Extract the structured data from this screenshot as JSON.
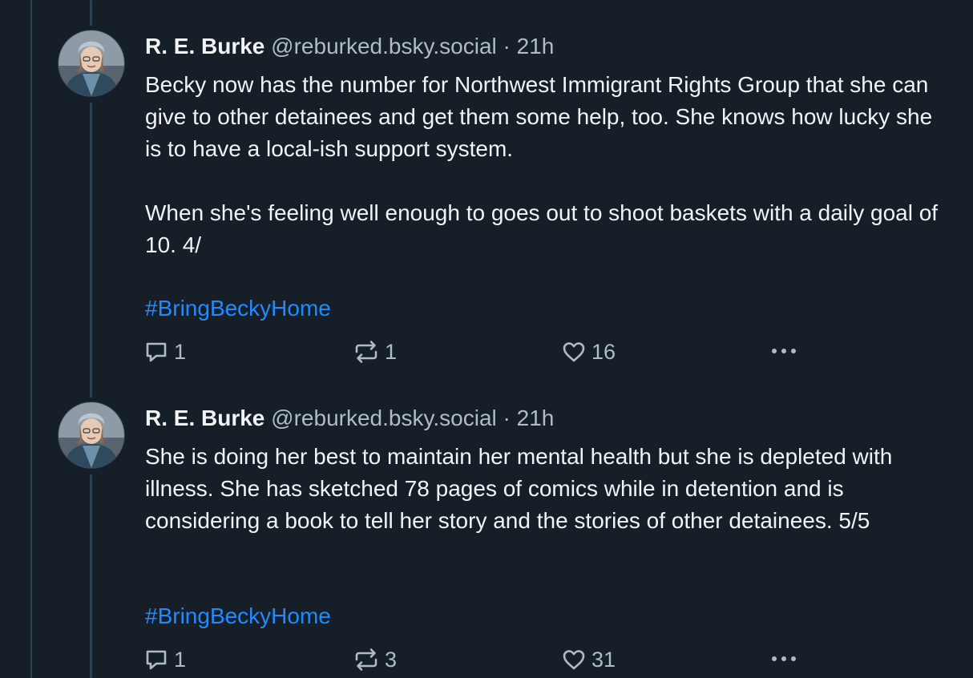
{
  "posts": [
    {
      "author": "R. E. Burke",
      "handle": "@reburked.bsky.social",
      "separator": "·",
      "time": "21h",
      "paragraphs": [
        "Becky now has the number for Northwest Immigrant Rights Group that she can give to other detainees and get them some help, too. She knows how lucky she is to have a local-ish support system.",
        "When she's feeling well enough to goes out to shoot baskets with a daily goal of 10. 4/"
      ],
      "hashtag": "#BringBeckyHome",
      "replies": "1",
      "reposts": "1",
      "likes": "16"
    },
    {
      "author": "R. E. Burke",
      "handle": "@reburked.bsky.social",
      "separator": "·",
      "time": "21h",
      "paragraphs": [
        "She is doing her best to maintain her mental health but she is depleted with illness. She has sketched 78 pages of comics while in detention and is considering a book to tell her story and the stories of other detainees. 5/5"
      ],
      "hashtag": "#BringBeckyHome",
      "replies": "1",
      "reposts": "3",
      "likes": "31"
    }
  ],
  "icons": {
    "reply": "reply-icon",
    "repost": "repost-icon",
    "like": "heart-icon",
    "more": "more-icon"
  },
  "colors": {
    "background": "#161e27",
    "text": "#f1f3f5",
    "muted": "#aebbc9",
    "link": "#208bfe",
    "thread_line": "#2e4052"
  }
}
